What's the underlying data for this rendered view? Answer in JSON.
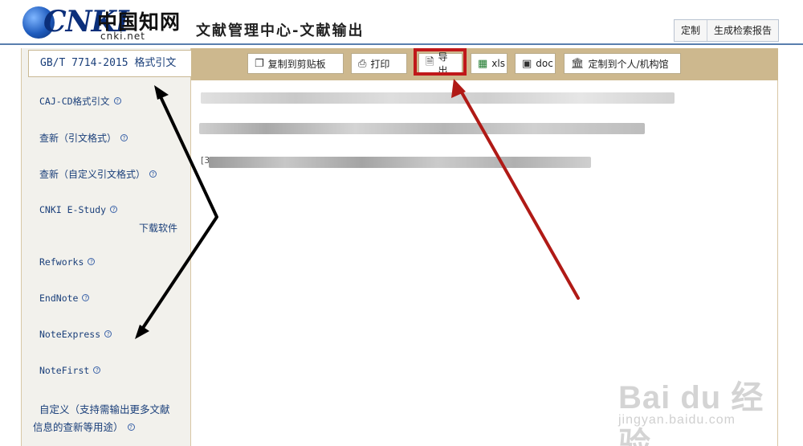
{
  "header": {
    "logo_brand": "CNKI",
    "logo_cn": "中国知网",
    "logo_domain": "cnki.net",
    "page_title": "文献管理中心-文献输出",
    "buttons": [
      "定制",
      "生成检索报告"
    ]
  },
  "sidebar": {
    "active_item": "GB/T 7714-2015 格式引文",
    "items": [
      {
        "label": "CAJ-CD格式引文"
      },
      {
        "label": "查新（引文格式）"
      },
      {
        "label": "查新（自定义引文格式）"
      },
      {
        "label": "CNKI E-Study"
      },
      {
        "label": "Refworks"
      },
      {
        "label": "EndNote"
      },
      {
        "label": "NoteExpress"
      },
      {
        "label": "NoteFirst"
      },
      {
        "label": "自定义（支持需输出更多文献"
      },
      {
        "label": "信息的查新等用途）"
      }
    ],
    "download_link": "下载软件",
    "help_glyph": "?"
  },
  "toolbar": {
    "copy": "复制到剪贴板",
    "print": "打印",
    "export": "导出",
    "xls": "xls",
    "doc": "doc",
    "custom": "定制到个人/机构馆"
  },
  "references": {
    "idx1": "[",
    "idx3": "[3"
  },
  "annotation_colors": {
    "black_arrow": "#000000",
    "red_arrow": "#b01a16",
    "highlight": "#c0181a"
  },
  "watermark": {
    "main": "Bai du 经验",
    "sub": "jingyan.baidu.com"
  }
}
